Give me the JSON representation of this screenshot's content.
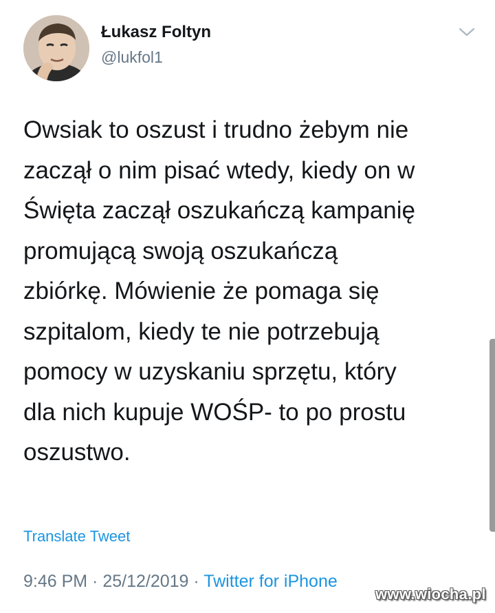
{
  "author": {
    "name": "Łukasz Foltyn",
    "handle": "@lukfol1"
  },
  "tweet": {
    "lines": [
      "Owsiak to oszust i trudno żebym nie",
      "zaczął o nim pisać wtedy, kiedy on w",
      "Święta zaczął oszukańczą kampanię",
      "promującą swoją oszukańczą",
      "zbiórkę. Mówienie że pomaga się",
      "szpitalom, kiedy te nie potrzebują",
      "pomocy w uzyskaniu sprzętu, który",
      "dla nich kupuje WOŚP- to po prostu",
      "oszustwo."
    ],
    "translate_label": "Translate Tweet"
  },
  "meta": {
    "time": "9:46 PM",
    "separator": " · ",
    "date": "25/12/2019",
    "source": "Twitter for iPhone"
  },
  "watermark": {
    "text": "www.wiocha.pl"
  },
  "icons": {
    "caret": "chevron-down-icon",
    "avatar": "profile-photo"
  },
  "colors": {
    "text": "#14171a",
    "secondary": "#657786",
    "link": "#1b95e0"
  }
}
